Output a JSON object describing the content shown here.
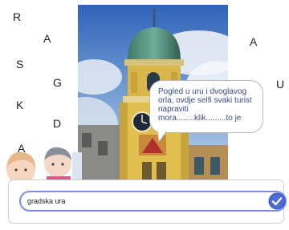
{
  "letters": [
    "R",
    "A",
    "S",
    "G",
    "K",
    "D",
    "A",
    "A",
    "U"
  ],
  "speech_bubble": {
    "text": "Pogled u uru i dvoglavog orla, ovdje selfi svaki turist napraviti mora........klik.........to je"
  },
  "answer": {
    "value": "gradska ura"
  },
  "colors": {
    "input_border": "#7a8ce8",
    "check_button": "#4d6bd6",
    "bubble_text": "#3a4a88"
  },
  "icons": [
    "checkmark-icon"
  ]
}
